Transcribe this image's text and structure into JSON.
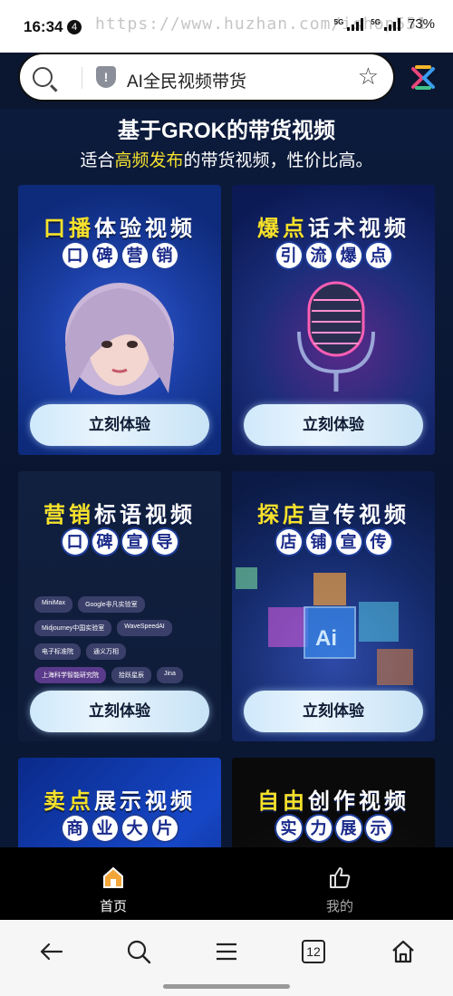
{
  "status_bar": {
    "time": "16:34",
    "notification_count": "4",
    "watermark": "https://www.huzhan.com/ishop551",
    "network_1": "5G",
    "network_2": "5G",
    "battery": "73%"
  },
  "search": {
    "query": "AI全民视频带货"
  },
  "hero": {
    "title": "基于GROK的带货视频",
    "subtitle_pre": "适合",
    "subtitle_highlight": "高频发布",
    "subtitle_post": "的带货视频，性价比高。"
  },
  "cards": [
    {
      "title_a": "口播",
      "title_b": "体验视频",
      "pills": [
        "口",
        "碑",
        "营",
        "销"
      ],
      "cta": "立刻体验"
    },
    {
      "title_a": "爆点",
      "title_b": "话术视频",
      "pills": [
        "引",
        "流",
        "爆",
        "点"
      ],
      "cta": "立刻体验"
    },
    {
      "title_a": "营销",
      "title_b": "标语视频",
      "pills": [
        "口",
        "碑",
        "宣",
        "导"
      ],
      "cta": "立刻体验",
      "logos": [
        "MiniMax",
        "Google非凡实验室",
        "Midjourney中国实验室",
        "WaveSpeedAI",
        "电子标准院",
        "通义万相",
        "上海科学智能研究院",
        "拾跃星辰",
        "Jina"
      ]
    },
    {
      "title_a": "探店",
      "title_b": "宣传视频",
      "pills": [
        "店",
        "铺",
        "宣",
        "传"
      ],
      "cta": "立刻体验"
    },
    {
      "title_a": "卖点",
      "title_b": "展示视频",
      "pills": [
        "商",
        "业",
        "大",
        "片"
      ],
      "cta": ""
    },
    {
      "title_a": "自由",
      "title_b": "创作视频",
      "pills": [
        "实",
        "力",
        "展",
        "示"
      ],
      "cta": ""
    }
  ],
  "tabbar": {
    "home_label": "首页",
    "mine_label": "我的"
  },
  "browser_nav": {
    "tab_count": "12"
  },
  "colors": {
    "highlight_yellow": "#f6e12b",
    "page_bg": "#0b1630"
  }
}
